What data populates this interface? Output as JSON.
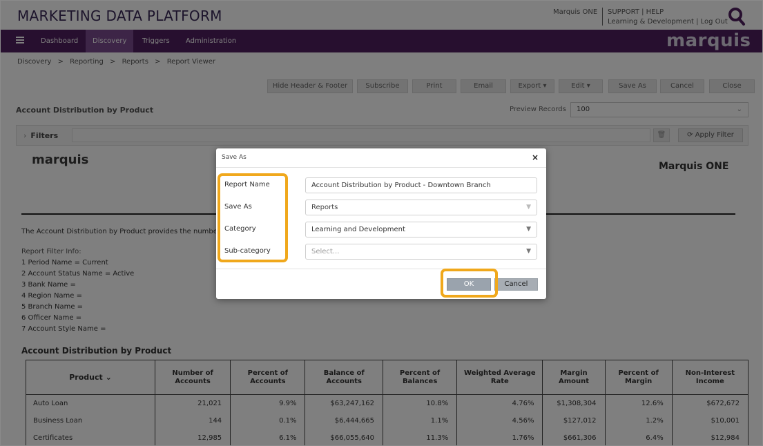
{
  "app": {
    "title": "MARKETING DATA PLATFORM",
    "user": "Marquis ONE",
    "top_links_line1": "SUPPORT | HELP",
    "top_links_line2": "Learning & Development | Log Out",
    "brand": "marquis"
  },
  "nav": {
    "items": [
      {
        "label": "Dashboard"
      },
      {
        "label": "Discovery"
      },
      {
        "label": "Triggers"
      },
      {
        "label": "Administration"
      }
    ],
    "active": "Discovery"
  },
  "breadcrumb": [
    "Discovery",
    ">",
    "Reporting",
    ">",
    "Reports",
    ">",
    "Report Viewer"
  ],
  "toolbar": {
    "hide_header_footer": "Hide Header & Footer",
    "subscribe": "Subscribe",
    "print": "Print",
    "email": "Email",
    "export": "Export ▾",
    "edit": "Edit ▾",
    "save_as": "Save As",
    "cancel": "Cancel",
    "close": "Close"
  },
  "report_header": {
    "title": "Account Distribution by Product",
    "preview_label": "Preview Records",
    "preview_value": "100"
  },
  "filters": {
    "label": "Filters",
    "apply": "Apply Filter"
  },
  "report": {
    "logo": "marquis",
    "org": "Marquis ONE",
    "description": "The Account Distribution by Product provides the number",
    "filter_heading": "Report Filter Info:",
    "filter_lines": [
      "1 Period Name = Current",
      "2 Account Status Name = Active",
      "3 Bank Name =",
      "4 Region Name =",
      "5 Branch Name =",
      "6 Officer Name =",
      "7 Account Style Name ="
    ],
    "table_title": "Account Distribution by Product",
    "columns": [
      "Product",
      "Number of Accounts",
      "Percent of Accounts",
      "Balance of Accounts",
      "Percent of Balances",
      "Weighted Average Rate",
      "Margin Amount",
      "Percent of Margin",
      "Non-Interest Income"
    ],
    "rows": [
      [
        "Auto Loan",
        "21,021",
        "9.9%",
        "$63,247,162",
        "10.8%",
        "4.76%",
        "$1,308,304",
        "12.6%",
        "$672,672"
      ],
      [
        "Business Loan",
        "144",
        "0.1%",
        "$6,444,665",
        "1.1%",
        "4.56%",
        "$127,012",
        "1.2%",
        "$10,001"
      ],
      [
        "Certificates",
        "12,985",
        "6.1%",
        "$66,055,640",
        "11.3%",
        "1.76%",
        "$661,306",
        "6.4%",
        "$12,984"
      ]
    ]
  },
  "dialog": {
    "title": "Save As",
    "close": "×",
    "labels": {
      "report_name": "Report Name",
      "save_as": "Save As",
      "category": "Category",
      "sub_category": "Sub-category"
    },
    "values": {
      "report_name": "Account Distribution by Product - Downtown Branch",
      "save_as": "Reports",
      "category": "Learning and Development",
      "sub_category_placeholder": "Select..."
    },
    "ok": "OK",
    "cancel": "Cancel"
  },
  "colors": {
    "nav_bg": "#4e1f5f",
    "nav_active": "#7a4a8e",
    "highlight": "#f0a81c"
  }
}
